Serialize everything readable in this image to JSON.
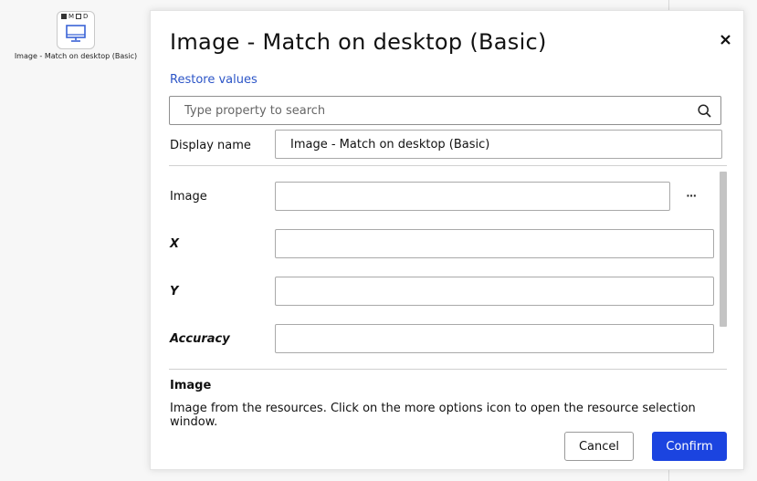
{
  "canvas": {
    "node": {
      "flags": [
        "M",
        "D"
      ],
      "icon": "monitor-icon",
      "label": "Image - Match on desktop (Basic)"
    }
  },
  "dialog": {
    "title": "Image - Match on desktop (Basic)",
    "close_icon": "close-icon",
    "restore_label": "Restore values",
    "search": {
      "placeholder": "Type property to search",
      "icon": "search-icon"
    },
    "display_name": {
      "label": "Display name",
      "value": "Image - Match on desktop (Basic)"
    },
    "properties": [
      {
        "label": "Image",
        "value": "",
        "more_icon": "more-options-icon"
      },
      {
        "label": "X",
        "value": ""
      },
      {
        "label": "Y",
        "value": ""
      },
      {
        "label": "Accuracy",
        "value": ""
      }
    ],
    "help": {
      "title": "Image",
      "text": "Image from the resources. Click on the more options icon to open the resource selection window."
    },
    "buttons": {
      "cancel": "Cancel",
      "confirm": "Confirm"
    },
    "colors": {
      "accent": "#1b44e0",
      "link": "#2c55c7"
    }
  }
}
